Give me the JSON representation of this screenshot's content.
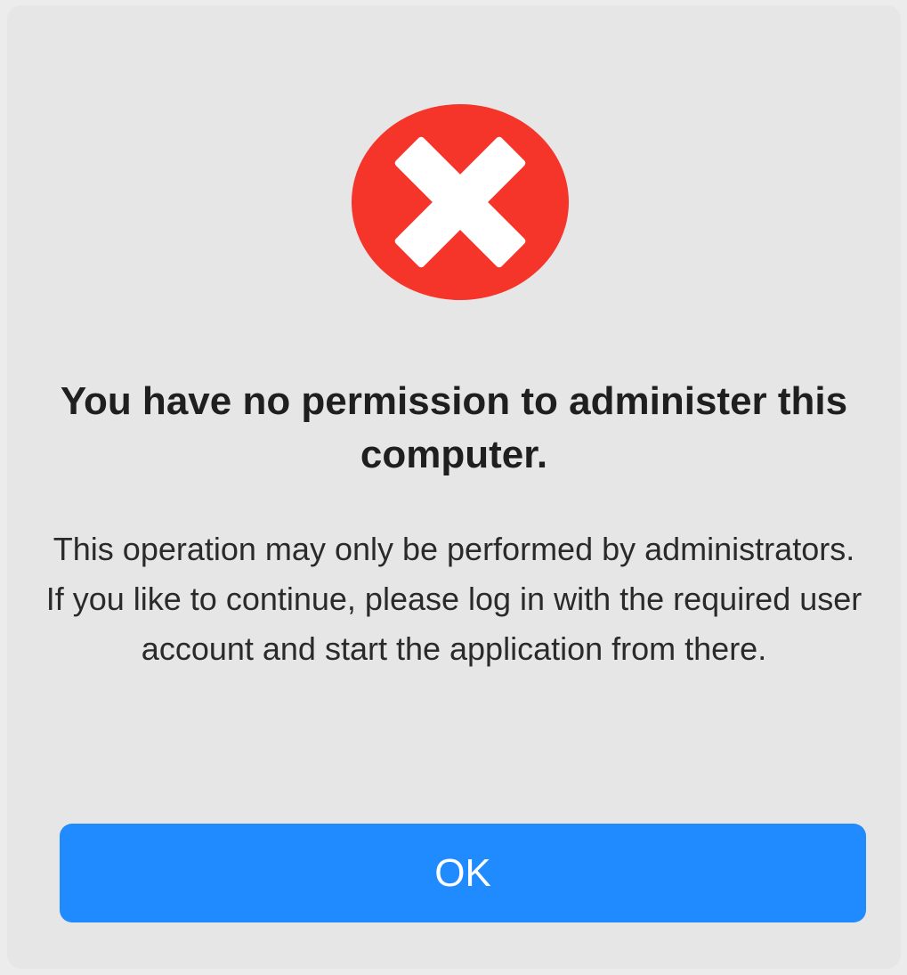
{
  "dialog": {
    "icon": "error-x-icon",
    "icon_color": "#f5342a",
    "title": "You have no permission to administer this computer.",
    "message": "This operation may only be performed by administrators. If you like to continue, please log in with the required user account and start the application from there.",
    "ok_label": "OK",
    "accent_color": "#1f8bff"
  }
}
